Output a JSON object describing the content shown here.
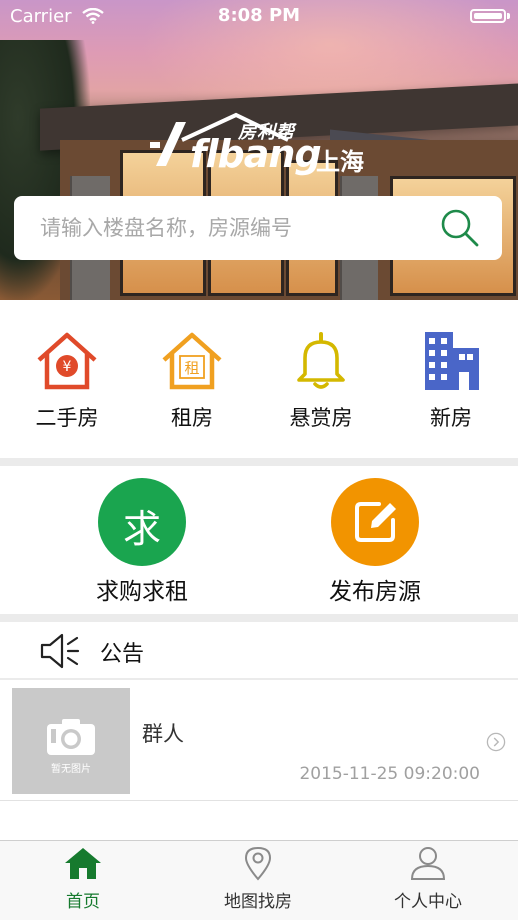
{
  "status_bar": {
    "carrier": "Carrier",
    "time": "8:08 PM"
  },
  "brand": {
    "name_cn": "房利帮",
    "name_en": "flbang",
    "city": "上海"
  },
  "search": {
    "placeholder": "请输入楼盘名称，房源编号"
  },
  "categories": [
    {
      "label": "二手房",
      "icon": "house-yuan-icon",
      "color": "#e04a2a"
    },
    {
      "label": "租房",
      "icon": "house-rent-icon",
      "color": "#f0a020"
    },
    {
      "label": "悬赏房",
      "icon": "bell-icon",
      "color": "#d4b800"
    },
    {
      "label": "新房",
      "icon": "building-icon",
      "color": "#4a66c8"
    }
  ],
  "actions": [
    {
      "label": "求购求租",
      "icon_text": "求",
      "color": "#1aa54f"
    },
    {
      "label": "发布房源",
      "icon": "edit-icon",
      "color": "#f29400"
    }
  ],
  "notice": {
    "label": "公告"
  },
  "listings": [
    {
      "title": "群人",
      "time": "2015-11-25 09:20:00",
      "thumb_text": "暂无图片"
    }
  ],
  "tabs": [
    {
      "label": "首页",
      "active": true,
      "color": "#167a2e"
    },
    {
      "label": "地图找房",
      "active": false
    },
    {
      "label": "个人中心",
      "active": false
    }
  ]
}
